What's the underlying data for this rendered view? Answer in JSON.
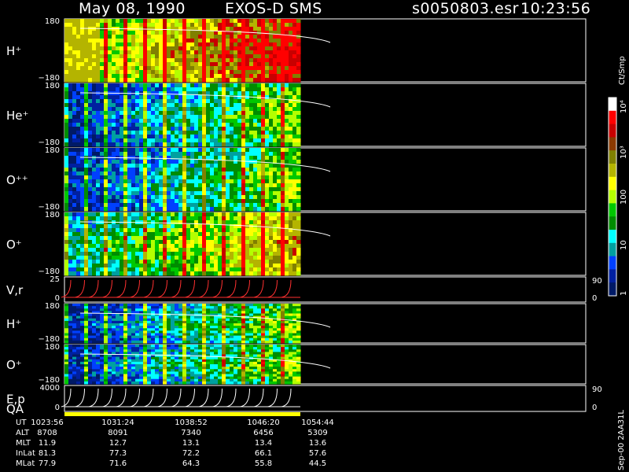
{
  "header": {
    "date": "May 08, 1990",
    "instrument": "EXOS-D SMS",
    "file": "s0050803.esr",
    "time": "10:23:56"
  },
  "colorbar": {
    "title": "Ct/Smp",
    "ticks": [
      "10⁴",
      "10³",
      "100",
      "10",
      "1"
    ],
    "colors": [
      "#ffffff",
      "#ff0000",
      "#c80000",
      "#8b3a00",
      "#808000",
      "#b4b400",
      "#ffff00",
      "#b4ff00",
      "#00c800",
      "#008c00",
      "#00ffff",
      "#00a0a0",
      "#0040ff",
      "#0020a0",
      "#001a66"
    ]
  },
  "footer_side": "Sep-00  2AA31L",
  "chart_data": {
    "type": "heatmap",
    "panels": [
      {
        "name": "H⁺",
        "ytop": "180",
        "ybot": "−180",
        "kind": "pitch"
      },
      {
        "name": "He⁺",
        "ytop": "180",
        "ybot": "−180",
        "kind": "pitch"
      },
      {
        "name": "O⁺⁺",
        "ytop": "180",
        "ybot": "−180",
        "kind": "pitch"
      },
      {
        "name": "O⁺",
        "ytop": "180",
        "ybot": "−180",
        "kind": "pitch"
      },
      {
        "name": "V,r",
        "ytop": "25",
        "ymid": "0",
        "right_top": "90",
        "right_bot": "0",
        "kind": "line"
      },
      {
        "name": "H⁺",
        "ytop": "180",
        "ybot": "−180",
        "kind": "pitch"
      },
      {
        "name": "O⁺",
        "ytop": "180",
        "ybot": "−180",
        "kind": "pitch"
      },
      {
        "name": "E,p",
        "name2": "QA",
        "ytop": "4000",
        "ymid": "0",
        "right_top": "90",
        "right_bot": "0",
        "kind": "line"
      }
    ],
    "time_axis": {
      "rows": [
        {
          "label": "UT",
          "values": [
            "1023:56",
            "1031:24",
            "1038:52",
            "1046:20",
            "1054:44"
          ]
        },
        {
          "label": "ALT",
          "values": [
            "8708",
            "8091",
            "7340",
            "6456",
            "5309"
          ]
        },
        {
          "label": "MLT",
          "values": [
            "11.9",
            "12.7",
            "13.1",
            "13.4",
            "13.6"
          ]
        },
        {
          "label": "InLat",
          "values": [
            "81.3",
            "77.3",
            "72.2",
            "66.1",
            "57.6"
          ]
        },
        {
          "label": "MLat",
          "values": [
            "77.9",
            "71.6",
            "64.3",
            "55.8",
            "44.5"
          ]
        }
      ]
    }
  }
}
